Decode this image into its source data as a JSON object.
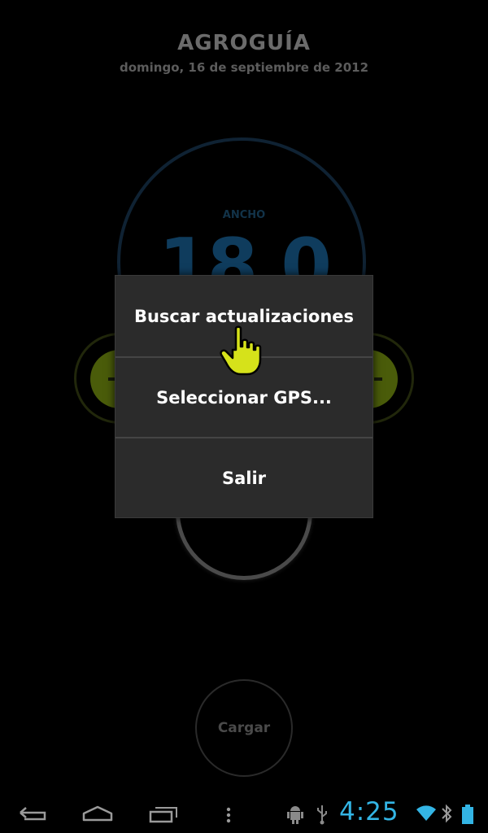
{
  "app": {
    "title": "AGROGUÍA",
    "date": "domingo, 16 de septiembre de 2012"
  },
  "dial": {
    "label": "ANCHO",
    "value": "18.0"
  },
  "buttons": {
    "cargar": "Cargar"
  },
  "menu": {
    "items": [
      {
        "label": "Buscar actualizaciones"
      },
      {
        "label": "Seleccionar GPS..."
      },
      {
        "label": "Salir"
      }
    ]
  },
  "system_bar": {
    "time": "4:25",
    "icons": [
      "back-icon",
      "home-icon",
      "recent-apps-icon",
      "menu-icon",
      "android-debug-icon",
      "usb-icon",
      "wifi-icon",
      "bluetooth-icon",
      "battery-icon"
    ]
  },
  "colors": {
    "accent_blue": "#33b5e5",
    "side_button_green": "#4a5c0a",
    "cursor_yellow": "#d6e21a"
  }
}
